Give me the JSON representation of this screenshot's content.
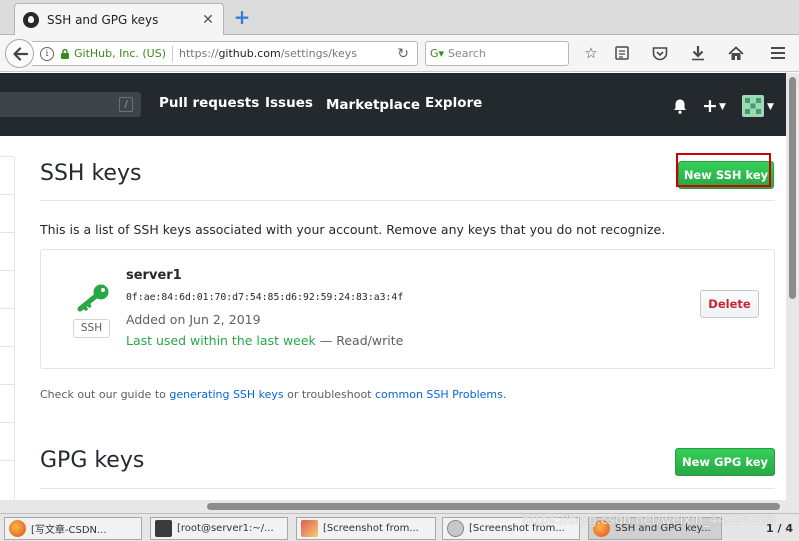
{
  "browser": {
    "tab_title": "SSH and GPG keys",
    "tab_close": "✕",
    "new_tab": "+",
    "identity_org": "GitHub, Inc. (US)",
    "url_scheme": "https://",
    "url_host": "github.com",
    "url_path": "/settings/keys",
    "search_placeholder": "Search"
  },
  "github_nav": {
    "search_shortcut": "/",
    "items": [
      "Pull requests",
      "Issues",
      "Marketplace",
      "Explore"
    ]
  },
  "ssh": {
    "heading": "SSH keys",
    "new_button": "New SSH key",
    "description": "This is a list of SSH keys associated with your account. Remove any keys that you do not recognize.",
    "keys": [
      {
        "title": "server1",
        "badge": "SSH",
        "fingerprint": "0f:ae:84:6d:01:70:d7:54:85:d6:92:59:24:83:a3:4f",
        "added": "Added on Jun 2, 2019",
        "last_used": "Last used within the last week",
        "access": " — Read/write",
        "delete_label": "Delete"
      }
    ],
    "guide_prefix": "Check out our guide to ",
    "guide_link1": "generating SSH keys",
    "guide_middle": " or troubleshoot ",
    "guide_link2": "common SSH Problems",
    "guide_suffix": "."
  },
  "gpg": {
    "heading": "GPG keys",
    "new_button": "New GPG key"
  },
  "taskbar": {
    "items": [
      {
        "label": "[写文章-CSDN...",
        "active": false
      },
      {
        "label": "[root@server1:~/...",
        "active": false
      },
      {
        "label": "[Screenshot from...",
        "active": false
      },
      {
        "label": "[Screenshot from...",
        "active": false
      },
      {
        "label": "SSH and GPG key...",
        "active": true
      }
    ],
    "pager": "1 / 4",
    "watermark": "https://blog.csdn.net/weixin_44224288"
  },
  "colors": {
    "github_header": "#24292e",
    "primary_green": "#28a745",
    "danger_red": "#cb2431",
    "link_blue": "#0366d6",
    "highlight_red": "#d10000"
  }
}
